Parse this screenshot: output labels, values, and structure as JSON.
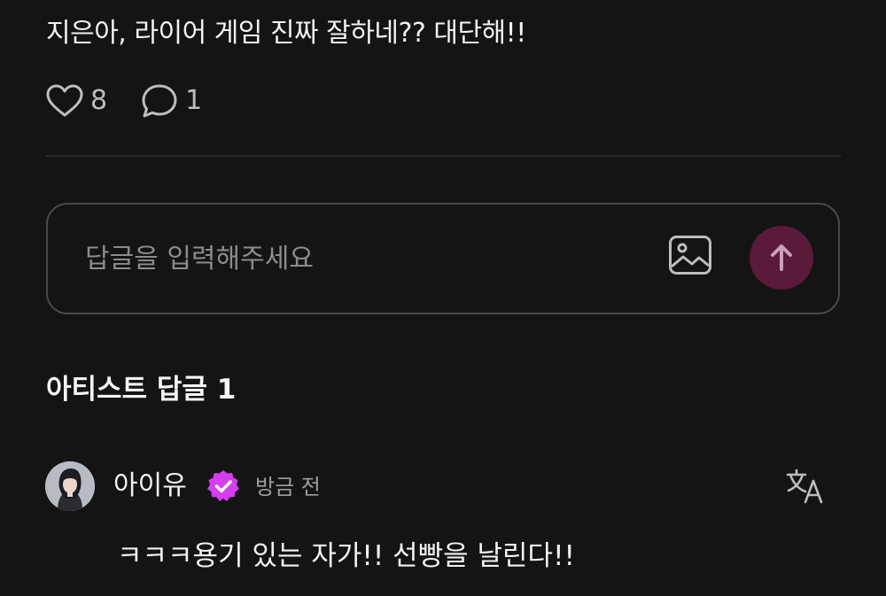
{
  "post": {
    "text": "지은아, 라이어 게임 진짜 잘하네?? 대단해!!",
    "likes": "8",
    "comments": "1"
  },
  "reply": {
    "placeholder": "답글을 입력해주세요"
  },
  "artist_replies": {
    "title": "아티스트 답글 1",
    "items": [
      {
        "author": "아이유",
        "time": "방금 전",
        "text": "ㅋㅋㅋ용기 있는 자가!! 선빵을 날린다!!"
      }
    ]
  },
  "icons": {
    "like": "heart-outline-icon",
    "comment": "speech-bubble-icon",
    "image": "image-icon",
    "send": "arrow-up-icon",
    "verified": "verified-badge-icon",
    "translate": "translate-icon"
  },
  "colors": {
    "background": "#141414",
    "send_button": "#5a1a38",
    "verified_badge": "#d63cf0"
  }
}
